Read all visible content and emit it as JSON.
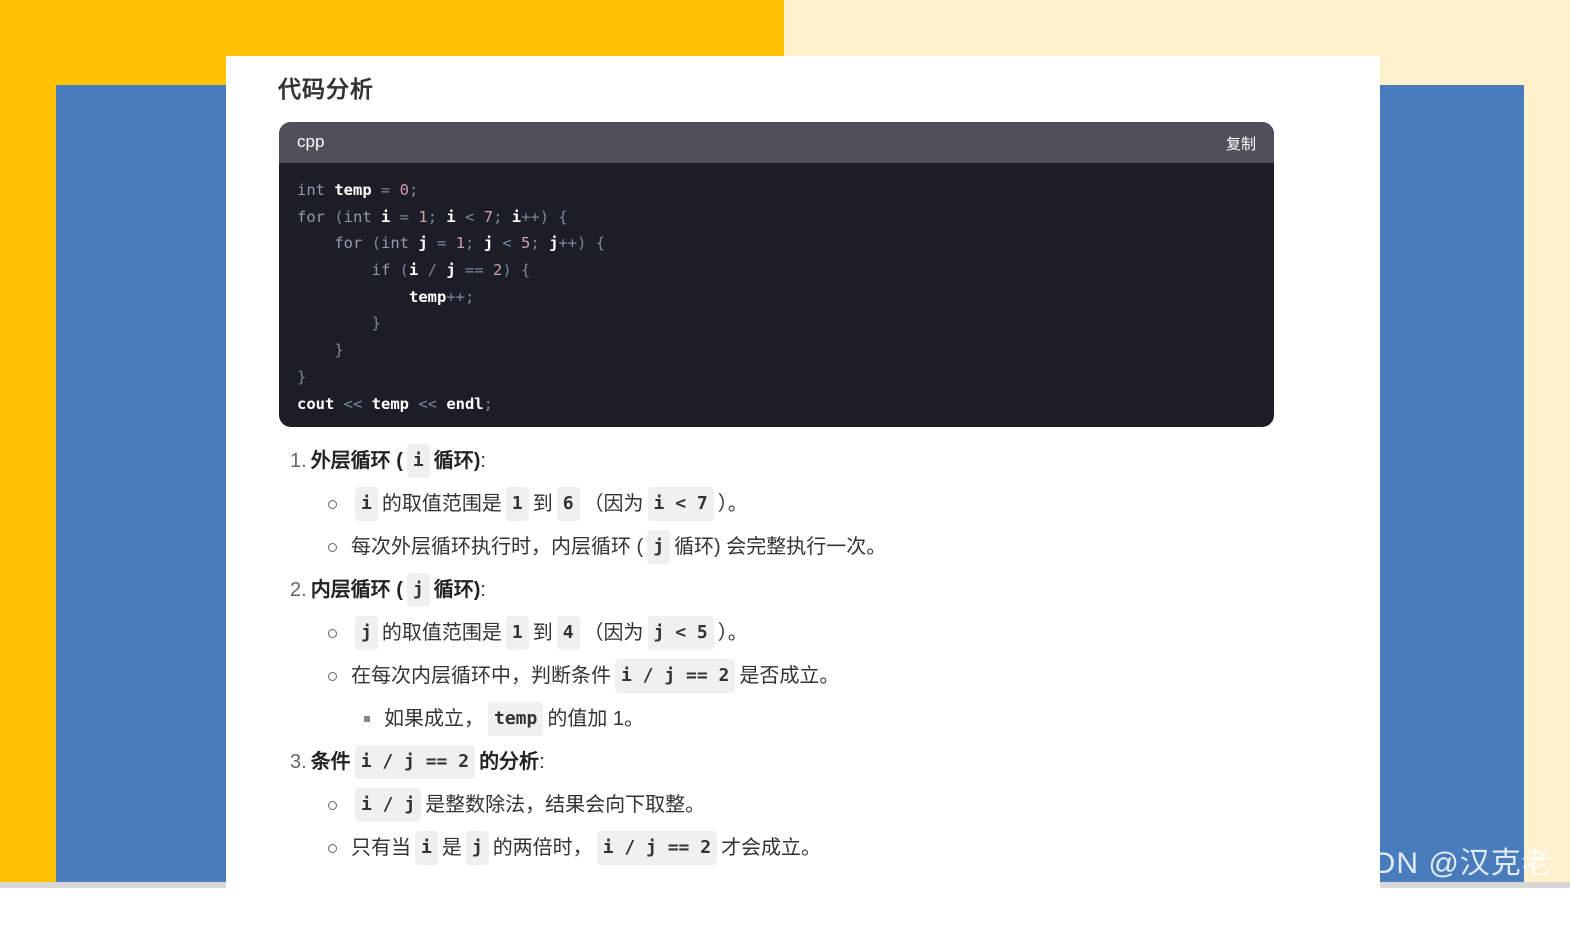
{
  "title": "代码分析",
  "code": {
    "language": "cpp",
    "copy_label": "复制",
    "lines": [
      [
        {
          "t": "int",
          "c": "kw"
        },
        {
          "t": " "
        },
        {
          "t": "temp",
          "c": "var"
        },
        {
          "t": " = ",
          "c": "op"
        },
        {
          "t": "0",
          "c": "num"
        },
        {
          "t": ";",
          "c": "op"
        }
      ],
      [
        {
          "t": "for",
          "c": "kw"
        },
        {
          "t": " (",
          "c": "op"
        },
        {
          "t": "int",
          "c": "kw"
        },
        {
          "t": " "
        },
        {
          "t": "i",
          "c": "var"
        },
        {
          "t": " = ",
          "c": "op"
        },
        {
          "t": "1",
          "c": "num"
        },
        {
          "t": "; ",
          "c": "op"
        },
        {
          "t": "i",
          "c": "var"
        },
        {
          "t": " < ",
          "c": "op"
        },
        {
          "t": "7",
          "c": "num"
        },
        {
          "t": "; ",
          "c": "op"
        },
        {
          "t": "i",
          "c": "var"
        },
        {
          "t": "++) {",
          "c": "op"
        }
      ],
      [
        {
          "t": "    "
        },
        {
          "t": "for",
          "c": "kw"
        },
        {
          "t": " (",
          "c": "op"
        },
        {
          "t": "int",
          "c": "kw"
        },
        {
          "t": " "
        },
        {
          "t": "j",
          "c": "var"
        },
        {
          "t": " = ",
          "c": "op"
        },
        {
          "t": "1",
          "c": "num"
        },
        {
          "t": "; ",
          "c": "op"
        },
        {
          "t": "j",
          "c": "var"
        },
        {
          "t": " < ",
          "c": "op"
        },
        {
          "t": "5",
          "c": "num"
        },
        {
          "t": "; ",
          "c": "op"
        },
        {
          "t": "j",
          "c": "var"
        },
        {
          "t": "++) {",
          "c": "op"
        }
      ],
      [
        {
          "t": "        "
        },
        {
          "t": "if",
          "c": "kw"
        },
        {
          "t": " (",
          "c": "op"
        },
        {
          "t": "i",
          "c": "var"
        },
        {
          "t": " / ",
          "c": "op"
        },
        {
          "t": "j",
          "c": "var"
        },
        {
          "t": " == ",
          "c": "op"
        },
        {
          "t": "2",
          "c": "num"
        },
        {
          "t": ") {",
          "c": "op"
        }
      ],
      [
        {
          "t": "            "
        },
        {
          "t": "temp",
          "c": "var"
        },
        {
          "t": "++;",
          "c": "op"
        }
      ],
      [
        {
          "t": "        "
        },
        {
          "t": "}",
          "c": "op"
        }
      ],
      [
        {
          "t": "    "
        },
        {
          "t": "}",
          "c": "op"
        }
      ],
      [
        {
          "t": "}",
          "c": "op"
        }
      ],
      [
        {
          "t": "cout",
          "c": "var"
        },
        {
          "t": " << ",
          "c": "op"
        },
        {
          "t": "temp",
          "c": "var"
        },
        {
          "t": " << ",
          "c": "op"
        },
        {
          "t": "endl",
          "c": "var"
        },
        {
          "t": ";",
          "c": "op"
        }
      ]
    ]
  },
  "analysis": [
    {
      "level": 1,
      "marker": "1.",
      "parts": [
        {
          "t": "外层循环 (",
          "b": true
        },
        {
          "code": "i"
        },
        {
          "t": "循环)",
          "b": true
        },
        {
          "t": ":"
        }
      ]
    },
    {
      "level": 2,
      "parts": [
        {
          "code": "i"
        },
        {
          "t": "的取值范围是"
        },
        {
          "code": "1"
        },
        {
          "t": "到"
        },
        {
          "code": "6"
        },
        {
          "t": "（因为"
        },
        {
          "code": "i < 7"
        },
        {
          "t": "）。"
        }
      ]
    },
    {
      "level": 2,
      "parts": [
        {
          "t": "每次外层循环执行时，内层循环 ("
        },
        {
          "code": "j"
        },
        {
          "t": "循环) 会完整执行一次。"
        }
      ]
    },
    {
      "level": 1,
      "marker": "2.",
      "parts": [
        {
          "t": "内层循环 (",
          "b": true
        },
        {
          "code": "j"
        },
        {
          "t": "循环)",
          "b": true
        },
        {
          "t": ":"
        }
      ]
    },
    {
      "level": 2,
      "parts": [
        {
          "code": "j"
        },
        {
          "t": "的取值范围是"
        },
        {
          "code": "1"
        },
        {
          "t": "到"
        },
        {
          "code": "4"
        },
        {
          "t": "（因为"
        },
        {
          "code": "j < 5"
        },
        {
          "t": "）。"
        }
      ]
    },
    {
      "level": 2,
      "parts": [
        {
          "t": "在每次内层循环中，判断条件"
        },
        {
          "code": "i / j == 2"
        },
        {
          "t": "是否成立。"
        }
      ]
    },
    {
      "level": 3,
      "parts": [
        {
          "t": "如果成立，"
        },
        {
          "code": "temp"
        },
        {
          "t": "的值加 1。"
        }
      ]
    },
    {
      "level": 1,
      "marker": "3.",
      "parts": [
        {
          "t": "条件",
          "b": true
        },
        {
          "code": "i / j == 2"
        },
        {
          "t": "的分析",
          "b": true
        },
        {
          "t": ":"
        }
      ]
    },
    {
      "level": 2,
      "parts": [
        {
          "code": "i / j"
        },
        {
          "t": "是整数除法，结果会向下取整。"
        }
      ]
    },
    {
      "level": 2,
      "parts": [
        {
          "t": "只有当"
        },
        {
          "code": "i"
        },
        {
          "t": "是"
        },
        {
          "code": "j"
        },
        {
          "t": "的两倍时，"
        },
        {
          "code": "i / j == 2"
        },
        {
          "t": "才会成立。"
        }
      ]
    }
  ],
  "watermark": "CSDN @汉克老师"
}
